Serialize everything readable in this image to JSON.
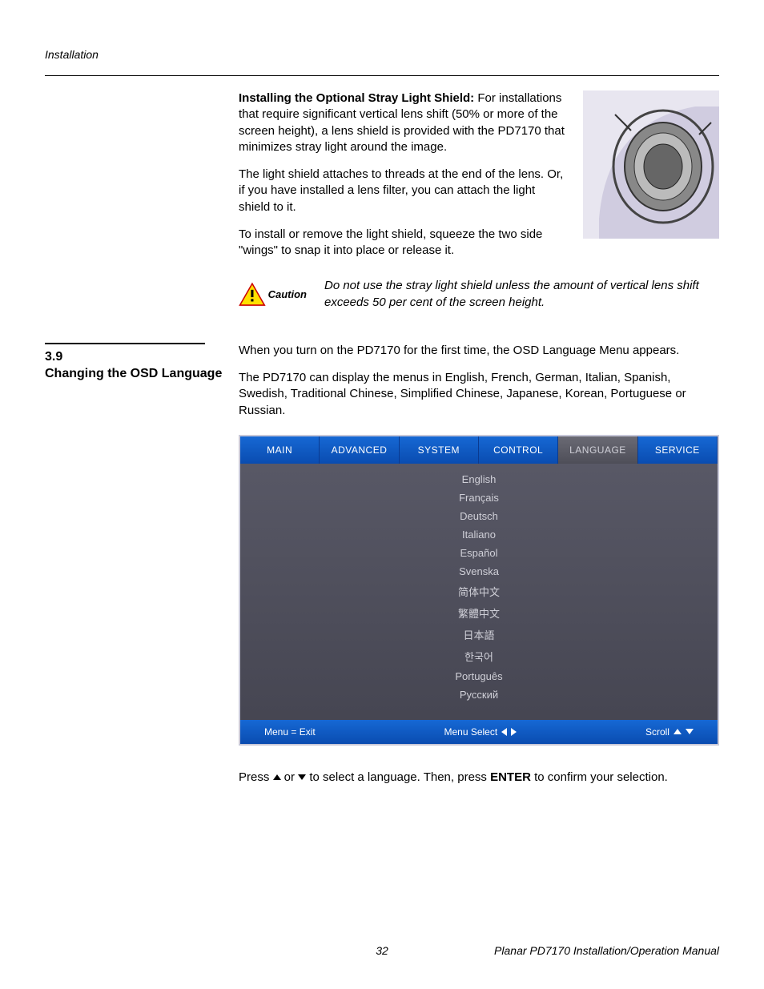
{
  "header": {
    "section": "Installation"
  },
  "install_shield": {
    "heading": "Installing the Optional Stray Light Shield: ",
    "p1_rest": "For installations that require significant vertical lens shift (50% or more of the screen height), a lens shield is provided with the PD7170 that minimizes stray light around the image.",
    "p2": "The light shield attaches to threads at the end of the lens. Or, if you have installed a lens filter, you can attach the light shield to it.",
    "p3": "To install or remove the light shield, squeeze the two side \"wings\" to snap it into place or release it."
  },
  "caution": {
    "label": "Caution",
    "text": "Do not use the stray light shield unless the amount of vertical lens shift exceeds 50 per cent of the screen height."
  },
  "section": {
    "number_title": "3.9\nChanging the OSD Language",
    "p1": "When you turn on the PD7170 for the first time, the OSD Language Menu appears.",
    "p2": "The PD7170 can display the menus in English, French, German, Italian, Spanish, Swedish, Traditional Chinese, Simplified Chinese, Japanese, Korean, Portuguese or Russian."
  },
  "osd": {
    "tabs": [
      "MAIN",
      "ADVANCED",
      "SYSTEM",
      "CONTROL",
      "LANGUAGE",
      "SERVICE"
    ],
    "active_tab_index": 4,
    "languages": [
      "English",
      "Français",
      "Deutsch",
      "Italiano",
      "Español",
      "Svenska",
      "简体中文",
      "繁體中文",
      "日本語",
      "한국어",
      "Português",
      "Русский"
    ],
    "footer": {
      "exit": "Menu = Exit",
      "select": "Menu Select",
      "scroll": "Scroll"
    }
  },
  "post_osd": {
    "pre": "Press ",
    "mid": " or ",
    "after": " to select a language. Then, press ",
    "enter": "ENTER",
    "end": " to confirm your selection."
  },
  "footer": {
    "page": "32",
    "title": "Planar PD7170 Installation/Operation Manual"
  }
}
